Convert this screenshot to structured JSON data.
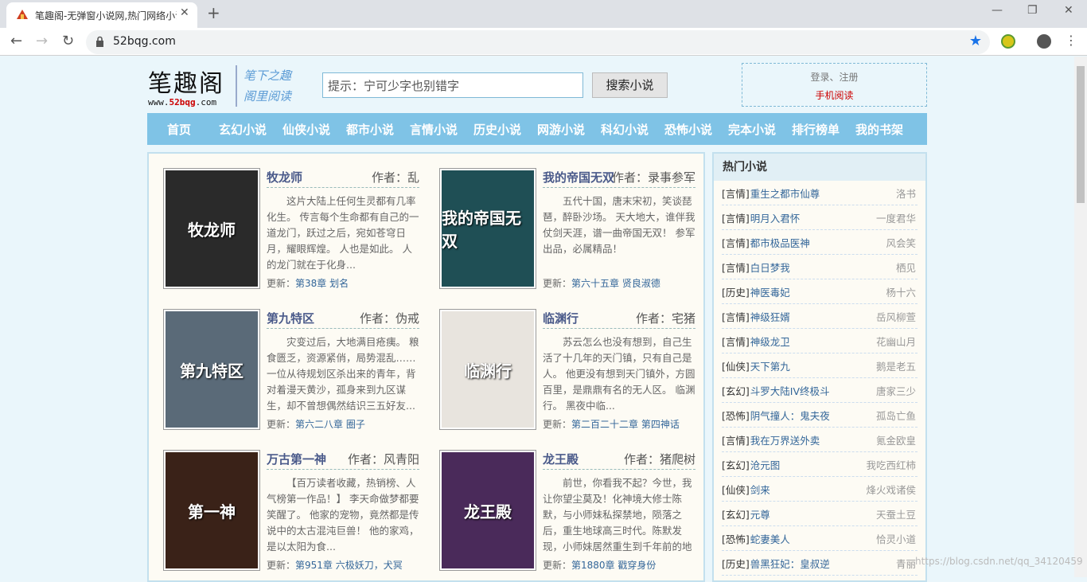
{
  "browser": {
    "tab_title": "笔趣阁-无弹窗小说网,热门网络小说",
    "url": "52bqg.com"
  },
  "header": {
    "logo_big": "笔趣阁",
    "logo_small_pre": "www.",
    "logo_small_mid": "52bqg",
    "logo_small_post": ".com",
    "slogan1": "笔下之趣",
    "slogan2": "阁里阅读",
    "search_placeholder": "提示：宁可少字也别错字",
    "search_button": "搜索小说",
    "login": "登录、注册",
    "mobile": "手机阅读"
  },
  "nav": [
    "首页",
    "玄幻小说",
    "仙侠小说",
    "都市小说",
    "言情小说",
    "历史小说",
    "网游小说",
    "科幻小说",
    "恐怖小说",
    "完本小说",
    "排行榜单",
    "我的书架"
  ],
  "books": [
    {
      "name": "牧龙师",
      "author": "作者：乱",
      "desc": "这片大陆上任何生灵都有几率化生。 传言每个生命都有自己的一道龙门，跃过之后，宛如苍穹日月，耀眼辉煌。 人也是如此。 人的龙门就在于化身...",
      "upd_label": "更新：",
      "upd": "第38章 划名",
      "cover": "牧龙师",
      "bg": "#2a2a2a"
    },
    {
      "name": "我的帝国无双",
      "author": "作者：录事参军",
      "desc": "五代十国，唐末宋初，笑谈琵琶，醉卧沙场。 天大地大，谁伴我仗剑天涯，谱一曲帝国无双！ 参军出品，必属精品！",
      "upd_label": "更新：",
      "upd": "第六十五章 贤良淑德",
      "cover": "我的帝国无双",
      "bg": "#1f4f55"
    },
    {
      "name": "第九特区",
      "author": "作者：伪戒",
      "desc": "灾变过后，大地满目疮痍。 粮食匮乏，资源紧俏，局势混乱…… 一位从待规划区杀出来的青年，背对着漫天黄沙，孤身来到九区谋生，却不曾想偶然结识三五好友...",
      "upd_label": "更新：",
      "upd": "第六二八章 圈子",
      "cover": "第九特区",
      "bg": "#5a6a78"
    },
    {
      "name": "临渊行",
      "author": "作者：宅猪",
      "desc": "苏云怎么也没有想到，自己生活了十几年的天门镇，只有自己是人。 他更没有想到天门镇外，方圆百里，是鼎鼎有名的无人区。 临渊行。 黑夜中临...",
      "upd_label": "更新：",
      "upd": "第二百二十二章 第四神话",
      "cover": "临渊行",
      "bg": "#e8e4de"
    },
    {
      "name": "万古第一神",
      "author": "作者：风青阳",
      "desc": "【百万读者收藏，热销榜、人气榜第一作品！】 李天命做梦都要笑醒了。 他家的宠物，竟然都是传说中的太古混沌巨兽！ 他的家鸡，是以太阳为食...",
      "upd_label": "更新：",
      "upd": "第951章 六极妖刀，犬冥",
      "cover": "第一神",
      "bg": "#3a2218"
    },
    {
      "name": "龙王殿",
      "author": "作者：猪爬树",
      "desc": "前世，你看我不起？今世，我让你望尘莫及！化神境大修士陈默，与小师妹私探禁地，陨落之后，重生地球高三时代。陈默发现，小师妹居然重生到千年前的地",
      "upd_label": "更新：",
      "upd": "第1880章 戳穿身份",
      "cover": "龙王殿",
      "bg": "#4a2a5a"
    }
  ],
  "hot": {
    "title": "热门小说",
    "items": [
      {
        "c": "[言情]",
        "t": "重生之都市仙尊",
        "a": "洛书"
      },
      {
        "c": "[言情]",
        "t": "明月入君怀",
        "a": "一度君华"
      },
      {
        "c": "[言情]",
        "t": "都市极品医神",
        "a": "风会笑"
      },
      {
        "c": "[言情]",
        "t": "白日梦我",
        "a": "栖见"
      },
      {
        "c": "[历史]",
        "t": "神医毒妃",
        "a": "杨十六"
      },
      {
        "c": "[言情]",
        "t": "神级狂婿",
        "a": "岳风柳萱"
      },
      {
        "c": "[言情]",
        "t": "神级龙卫",
        "a": "花幽山月"
      },
      {
        "c": "[仙侠]",
        "t": "天下第九",
        "a": "鹅是老五"
      },
      {
        "c": "[玄幻]",
        "t": "斗罗大陆IV终极斗",
        "a": "唐家三少"
      },
      {
        "c": "[恐怖]",
        "t": "阴气撞人：鬼夫夜",
        "a": "孤岛亡鱼"
      },
      {
        "c": "[言情]",
        "t": "我在万界送外卖",
        "a": "氪金欧皇"
      },
      {
        "c": "[玄幻]",
        "t": "沧元图",
        "a": "我吃西红柿"
      },
      {
        "c": "[仙侠]",
        "t": "剑来",
        "a": "烽火戏诸侯"
      },
      {
        "c": "[玄幻]",
        "t": "元尊",
        "a": "天蚕土豆"
      },
      {
        "c": "[恐怖]",
        "t": "蛇妻美人",
        "a": "恰灵小道"
      },
      {
        "c": "[历史]",
        "t": "兽黑狂妃：皇叔逆",
        "a": "青丽"
      }
    ]
  },
  "watermark": "https://blog.csdn.net/qq_34120459"
}
